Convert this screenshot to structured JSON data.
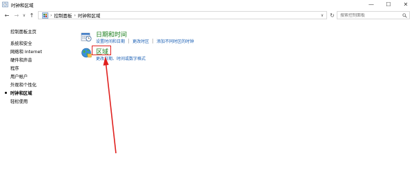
{
  "window": {
    "title": "时钟和区域",
    "minimize": "—",
    "maximize": "☐",
    "close": "✕"
  },
  "nav": {
    "back": "←",
    "forward": "→",
    "history": "∨",
    "up": "↑"
  },
  "address": {
    "breadcrumb": [
      "控制面板",
      "时钟和区域"
    ],
    "separator": "›",
    "dropdown": "∨",
    "refresh": "↻"
  },
  "search": {
    "placeholder": "搜索控制面板"
  },
  "sidebar": {
    "items": [
      {
        "label": "控制面板主页"
      },
      {
        "label": "系统和安全"
      },
      {
        "label": "网络和 Internet"
      },
      {
        "label": "硬件和声音"
      },
      {
        "label": "程序"
      },
      {
        "label": "用户帐户"
      },
      {
        "label": "外观和个性化"
      },
      {
        "label": "时钟和区域",
        "current": true
      },
      {
        "label": "轻松使用"
      }
    ]
  },
  "categories": [
    {
      "title": "日期和时间",
      "icon": "clock-icon",
      "links": [
        "设置时间和日期",
        "更改时区",
        "添加不同时区的时钟"
      ]
    },
    {
      "title": "区域",
      "icon": "globe-icon",
      "links": [
        "更改日期、时间或数字格式"
      ]
    }
  ],
  "colors": {
    "category_title": "#1a7e1a",
    "link": "#1a5fb4",
    "annotation": "#e0201e"
  }
}
